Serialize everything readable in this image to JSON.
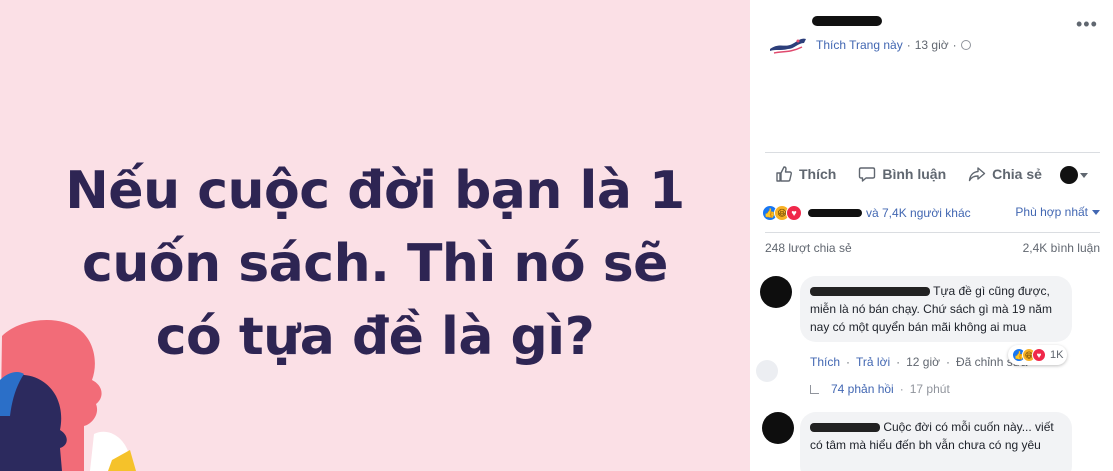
{
  "post_image": {
    "headline_lines": [
      "Nếu cuộc đời bạn là 1",
      "cuốn sách. Thì nó sẽ",
      "có tựa đề là gì?"
    ]
  },
  "page_header": {
    "like_page": "Thích Trang này",
    "separator": "·",
    "time": "13 giờ",
    "privacy_icon": "globe-icon",
    "menu_icon": "more-horizontal-icon"
  },
  "actions": {
    "like": "Thích",
    "comment": "Bình luận",
    "share": "Chia sẻ"
  },
  "reactions": {
    "icons": [
      "like-icon",
      "haha-icon",
      "love-icon"
    ],
    "others_text": "và 7,4K người khác",
    "sort_label": "Phù hợp nhất"
  },
  "stats": {
    "shares": "248 lượt chia sẻ",
    "comments": "2,4K bình luận"
  },
  "comments": [
    {
      "text": "Tựa đề gì cũng được, miễn là nó bán chạy. Chứ sách gì mà 19 năm nay có một quyển bán mãi không ai mua",
      "like": "Thích",
      "reply": "Trả lời",
      "time": "12 giờ",
      "edited": "Đã chỉnh sửa",
      "reaction_count": "1K",
      "replies_label": "74 phản hồi",
      "replies_time": "17 phút"
    },
    {
      "text": "Cuộc đời có mỗi cuốn này... viết có tâm    mà     hiểu đến bh vẫn chưa có ng yêu"
    }
  ],
  "colors": {
    "image_bg": "#fbe0e6",
    "headline": "#2e2553",
    "link_blue": "#4267b2",
    "meta_gray": "#616770"
  }
}
